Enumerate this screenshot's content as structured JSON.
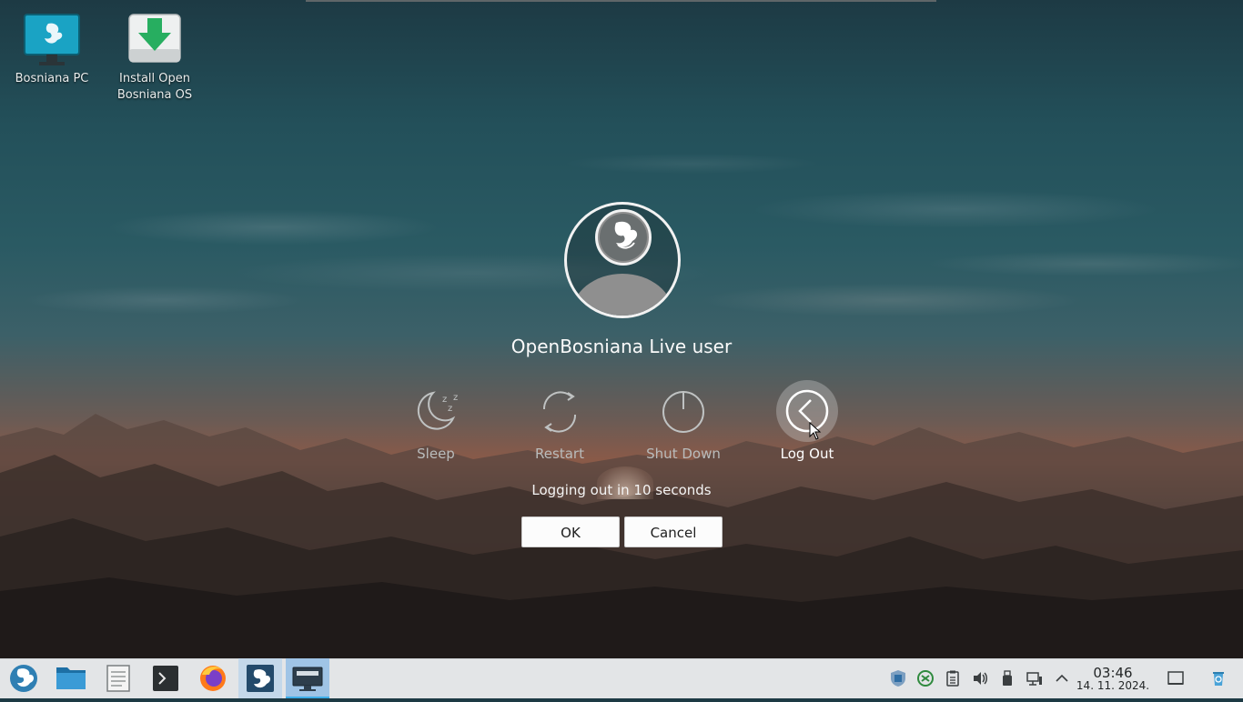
{
  "desktop": {
    "icons": [
      {
        "label": "Bosniana PC",
        "icon": "computer-icon"
      },
      {
        "label": "Install Open Bosniana OS",
        "icon": "download-install-icon"
      }
    ]
  },
  "logout_dialog": {
    "username": "OpenBosniana Live user",
    "actions": [
      {
        "label": "Sleep",
        "icon": "sleep-icon",
        "active": false
      },
      {
        "label": "Restart",
        "icon": "restart-icon",
        "active": false
      },
      {
        "label": "Shut Down",
        "icon": "shutdown-icon",
        "active": false
      },
      {
        "label": "Log Out",
        "icon": "logout-icon",
        "active": true
      }
    ],
    "countdown_text": "Logging out in 10 seconds",
    "ok_label": "OK",
    "cancel_label": "Cancel"
  },
  "taskbar": {
    "launchers": [
      "app-launcher-icon",
      "file-manager-icon",
      "text-editor-icon",
      "terminal-icon",
      "firefox-icon",
      "bosniana-app-icon",
      "desktop-display-icon"
    ],
    "tray": [
      "shield-updates-icon",
      "sync-icon",
      "clipboard-icon",
      "volume-icon",
      "usb-device-icon",
      "network-icon",
      "expand-tray-icon"
    ],
    "clock": {
      "time": "03:46",
      "date": "14. 11. 2024."
    }
  },
  "colors": {
    "accent": "#3daee9",
    "taskbar_bg": "#e3e5e7",
    "highlight": "#c4d8ea"
  }
}
